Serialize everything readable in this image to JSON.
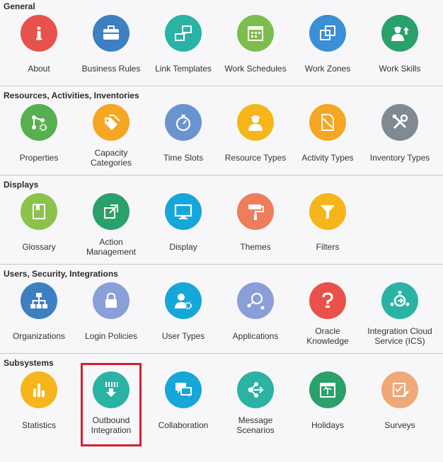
{
  "sections": [
    {
      "title": "General",
      "items": [
        {
          "label": "About",
          "icon": "info-icon",
          "color": "#e8524a"
        },
        {
          "label": "Business Rules",
          "icon": "briefcase-icon",
          "color": "#3e7fc1"
        },
        {
          "label": "Link Templates",
          "icon": "link-templates-icon",
          "color": "#2ab3a5"
        },
        {
          "label": "Work Schedules",
          "icon": "calendar-icon",
          "color": "#7dbd4c"
        },
        {
          "label": "Work Zones",
          "icon": "squares-icon",
          "color": "#3b8fd4"
        },
        {
          "label": "Work Skills",
          "icon": "worker-upload-icon",
          "color": "#2aa06a"
        }
      ]
    },
    {
      "title": "Resources, Activities, Inventories",
      "items": [
        {
          "label": "Properties",
          "icon": "share-gear-icon",
          "color": "#55b04d"
        },
        {
          "label": "Capacity\nCategories",
          "icon": "tags-icon",
          "color": "#f5a623"
        },
        {
          "label": "Time Slots",
          "icon": "stopwatch-icon",
          "color": "#6b93cf"
        },
        {
          "label": "Resource Types",
          "icon": "worker-icon",
          "color": "#f6b51b"
        },
        {
          "label": "Activity Types",
          "icon": "document-cancel-icon",
          "color": "#f5a623"
        },
        {
          "label": "Inventory Types",
          "icon": "tools-icon",
          "color": "#7f8a93"
        }
      ]
    },
    {
      "title": "Displays",
      "items": [
        {
          "label": "Glossary",
          "icon": "book-icon",
          "color": "#8bc34a"
        },
        {
          "label": "Action\nManagement",
          "icon": "external-link-icon",
          "color": "#2aa06a"
        },
        {
          "label": "Display",
          "icon": "monitor-icon",
          "color": "#16a7d8"
        },
        {
          "label": "Themes",
          "icon": "paint-roller-icon",
          "color": "#ee7d5b"
        },
        {
          "label": "Filters",
          "icon": "filter-icon",
          "color": "#f6b51b"
        }
      ]
    },
    {
      "title": "Users, Security, Integrations",
      "items": [
        {
          "label": "Organizations",
          "icon": "org-chart-icon",
          "color": "#3e7fc1"
        },
        {
          "label": "Login Policies",
          "icon": "lock-icon",
          "color": "#8a9ed8"
        },
        {
          "label": "User Types",
          "icon": "user-gear-icon",
          "color": "#16a7d8"
        },
        {
          "label": "Applications",
          "icon": "connections-icon",
          "color": "#8a9ed8"
        },
        {
          "label": "Oracle\nKnowledge",
          "icon": "question-icon",
          "color": "#e8524a"
        },
        {
          "label": "Integration Cloud\nService (ICS)",
          "icon": "integration-hub-icon",
          "color": "#2ab3a5"
        }
      ]
    },
    {
      "title": "Subsystems",
      "items": [
        {
          "label": "Statistics",
          "icon": "bar-chart-icon",
          "color": "#f6b51b"
        },
        {
          "label": "Outbound\nIntegration",
          "icon": "outbound-download-icon",
          "color": "#2ab3a5"
        },
        {
          "label": "Collaboration",
          "icon": "chat-icon",
          "color": "#16a7d8"
        },
        {
          "label": "Message\nScenarios",
          "icon": "share-network-icon",
          "color": "#2ab3a5"
        },
        {
          "label": "Holidays",
          "icon": "holiday-calendar-icon",
          "color": "#2aa06a"
        },
        {
          "label": "Surveys",
          "icon": "survey-edit-icon",
          "color": "#f0a878"
        }
      ]
    }
  ]
}
